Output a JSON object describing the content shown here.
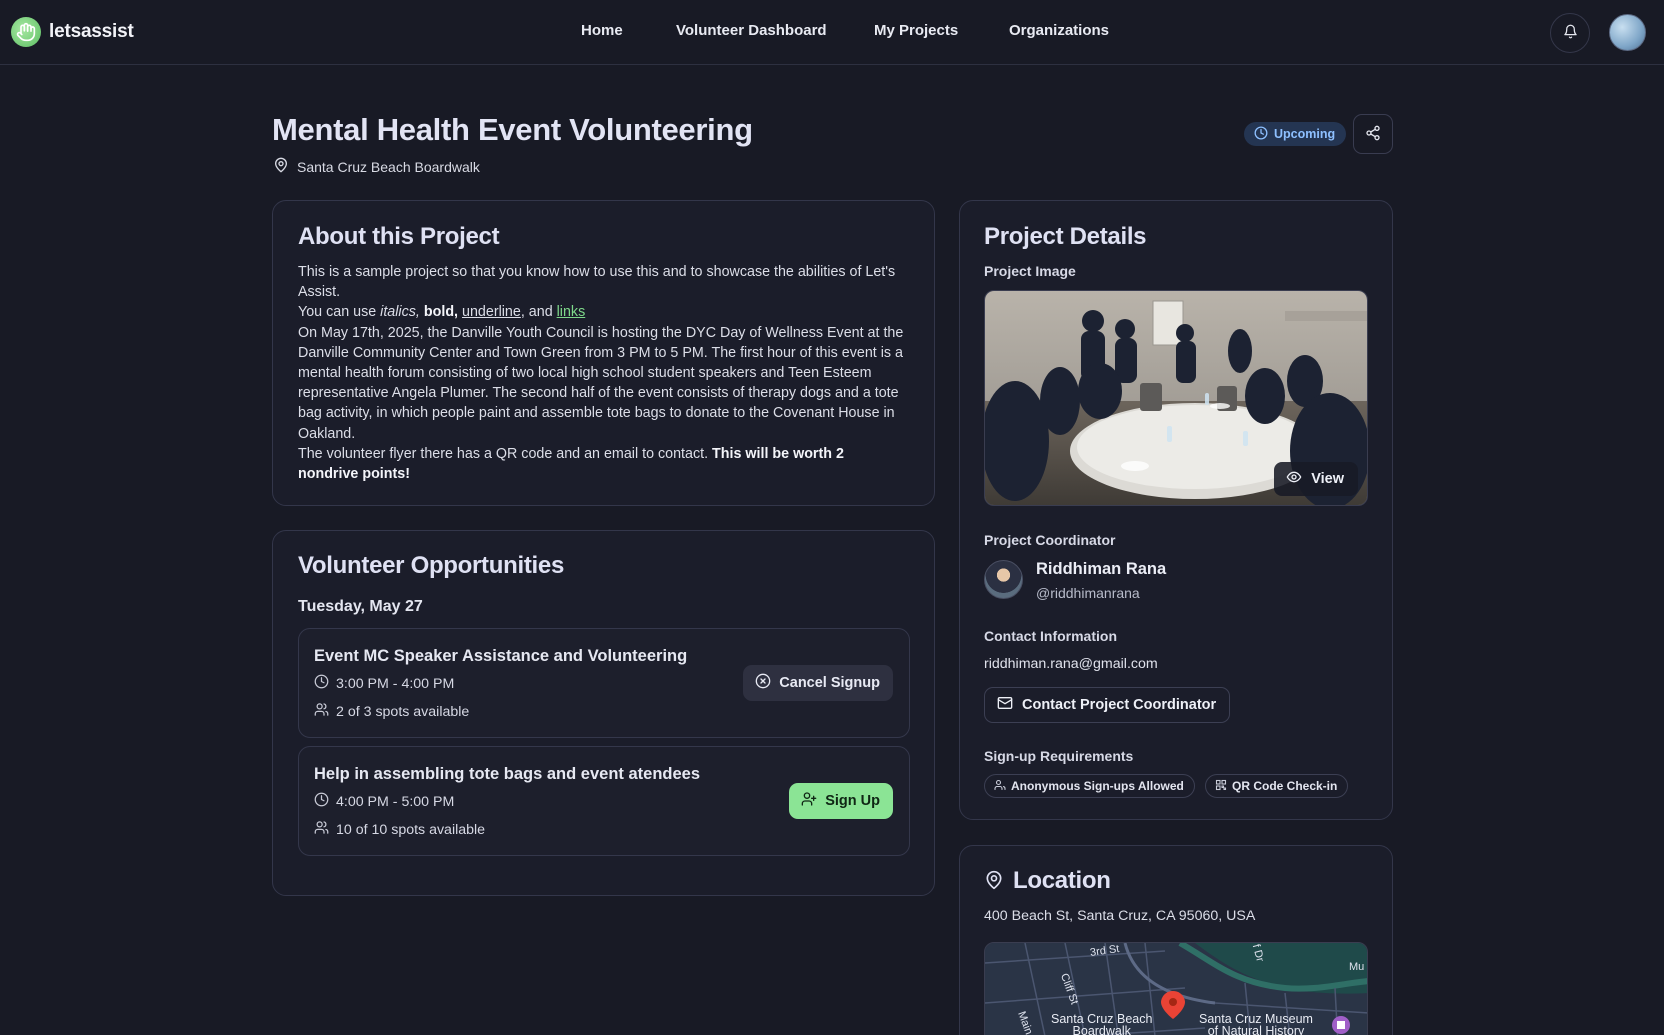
{
  "navbar": {
    "brand": "letsassist",
    "links": [
      "Home",
      "Volunteer Dashboard",
      "My Projects",
      "Organizations"
    ]
  },
  "project": {
    "title": "Mental Health Event Volunteering",
    "location": "Santa Cruz Beach Boardwalk",
    "status": "Upcoming",
    "status_color": "#8ec0ff"
  },
  "about": {
    "title": "About this Project",
    "line1": "This is a sample project so that you know how to use this and to showcase the abilities of Let's Assist.",
    "line2_prefix": "You can use ",
    "line2_italics": "italics,",
    "line2_space1": " ",
    "line2_bold": "bold,",
    "line2_space2": " ",
    "line2_underline": "underline",
    "line2_and": ", and ",
    "line2_link": "links",
    "paragraph": "On May 17th, 2025, the Danville Youth Council is hosting the DYC Day of Wellness Event at the Danville Community Center and Town Green from 3 PM to 5 PM. The first hour of this event is a mental health forum consisting of two local high school student speakers and Teen Esteem representative Angela Plumer. The second half of the event consists of therapy dogs and a tote bag activity, in which people paint and assemble tote bags to donate to the Covenant House in Oakland.",
    "last_prefix": "The volunteer flyer there has a QR code and an email to contact. ",
    "last_bold": "This will be worth 2 nondrive points!"
  },
  "opportunities": {
    "title": "Volunteer Opportunities",
    "date": "Tuesday, May 27",
    "slots": [
      {
        "title": "Event MC Speaker Assistance and Volunteering",
        "time": "3:00 PM - 4:00 PM",
        "spots": "2 of 3 spots available",
        "action": "Cancel Signup"
      },
      {
        "title": "Help in assembling tote bags and event atendees",
        "time": "4:00 PM - 5:00 PM",
        "spots": "10 of 10 spots available",
        "action": "Sign Up"
      }
    ]
  },
  "details": {
    "title": "Project Details",
    "image_label": "Project Image",
    "view_label": "View",
    "coordinator_label": "Project Coordinator",
    "coordinator_name": "Riddhiman Rana",
    "coordinator_handle": "@riddhimanrana",
    "contact_label": "Contact Information",
    "contact_email": "riddhiman.rana@gmail.com",
    "contact_button": "Contact Project Coordinator",
    "requirements_label": "Sign-up Requirements",
    "requirements": [
      "Anonymous Sign-ups Allowed",
      "QR Code Check-in"
    ]
  },
  "location": {
    "title": "Location",
    "address": "400 Beach St, Santa Cruz, CA 95060, USA",
    "map_labels": {
      "street1": "3rd St",
      "street2": "Cliff St",
      "street3": "Main",
      "street4": "Mu",
      "place1": "Santa Cruz Beach",
      "place1b": "Boardwalk",
      "place2": "Santa Cruz Museum",
      "place2b": "of Natural History",
      "road": "f Dr"
    }
  },
  "colors": {
    "accent_green": "#8be495",
    "link_green": "#7ed88a",
    "background": "#181a25"
  }
}
